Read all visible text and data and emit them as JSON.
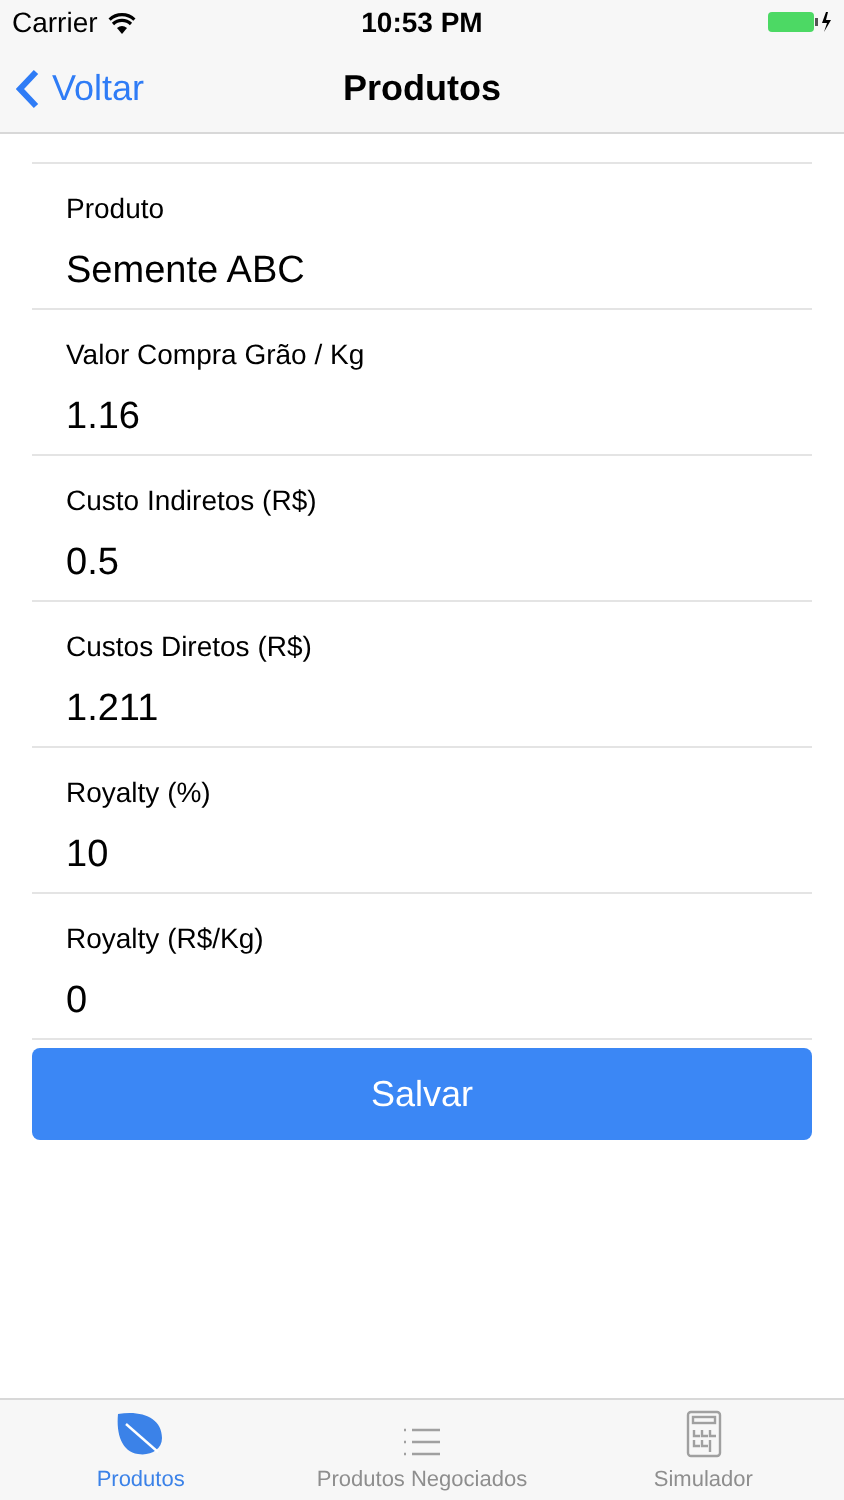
{
  "status_bar": {
    "carrier": "Carrier",
    "time": "10:53 PM"
  },
  "nav": {
    "back": "Voltar",
    "title": "Produtos"
  },
  "fields": [
    {
      "label": "Produto",
      "value": "Semente ABC"
    },
    {
      "label": "Valor Compra Grão / Kg",
      "value": "1.16"
    },
    {
      "label": "Custo Indiretos (R$)",
      "value": "0.5"
    },
    {
      "label": "Custos Diretos (R$)",
      "value": "1.211"
    },
    {
      "label": "Royalty (%)",
      "value": "10"
    },
    {
      "label": "Royalty (R$/Kg)",
      "value": "0"
    }
  ],
  "save_button": "Salvar",
  "tabs": [
    {
      "kind": "leaf",
      "label": "Produtos",
      "selected": true
    },
    {
      "kind": "list",
      "label": "Produtos Negociados",
      "selected": false
    },
    {
      "kind": "calculator",
      "label": "Simulador",
      "selected": false
    }
  ]
}
